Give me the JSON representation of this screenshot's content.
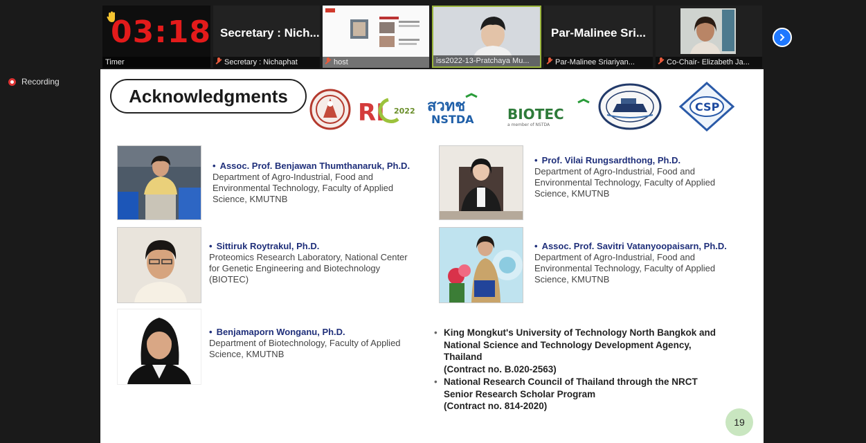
{
  "meeting": {
    "timer": {
      "value": "03:18",
      "label": "Timer"
    },
    "tiles": [
      {
        "big_name": "Secretary : Nich...",
        "label": "Secretary : Nichaphat"
      },
      {
        "label": "host"
      },
      {
        "label": "iss2022-13-Pratchaya Mu..."
      },
      {
        "big_name": "Par-Malinee Sri...",
        "label": "Par-Malinee Sriariyan..."
      },
      {
        "label": "Co-Chair- Elizabeth Ja..."
      }
    ],
    "recording_label": "Recording",
    "colors": {
      "timer": "#e31b1b",
      "next_button": "#1f78ff",
      "recording_dot": "#dd3333"
    }
  },
  "slide": {
    "title": "Acknowledgments",
    "logos": {
      "ri_year": "2022",
      "nstda_thai": "สวทช",
      "nstda": "NSTDA",
      "biotec": "BIOTEC",
      "biotec_tagline": "a member of NSTDA",
      "csp": "CSP"
    },
    "people": [
      {
        "name": "Assoc. Prof. Benjawan Thumthanaruk, Ph.D.",
        "desc": "Department of Agro-Industrial, Food and Environmental Technology, Faculty of Applied Science, KMUTNB"
      },
      {
        "name": "Prof. Vilai Rungsardthong, Ph.D.",
        "desc": "Department of Agro-Industrial, Food and Environmental Technology, Faculty of Applied Science, KMUTNB"
      },
      {
        "name": "Sittiruk Roytrakul, Ph.D.",
        "desc": "Proteomics Research Laboratory, National Center for Genetic Engineering and Biotechnology (BIOTEC)"
      },
      {
        "name": "Assoc. Prof. Savitri Vatanyoopaisarn, Ph.D.",
        "desc": "Department of Agro-Industrial, Food and Environmental Technology, Faculty of Applied Science, KMUTNB"
      },
      {
        "name": "Benjamaporn Wonganu, Ph.D.",
        "desc": "Department of Biotechnology, Faculty of Applied Science, KMUTNB"
      }
    ],
    "funding": [
      {
        "text": "King Mongkut's University of Technology North Bangkok and National Science and Technology Development Agency, Thailand",
        "contract": "(Contract no. B.020-2563)"
      },
      {
        "text": "National Research Council of Thailand through the NRCT Senior Research Scholar Program",
        "contract": "(Contract no. 814-2020)"
      }
    ],
    "page_number": "19"
  }
}
